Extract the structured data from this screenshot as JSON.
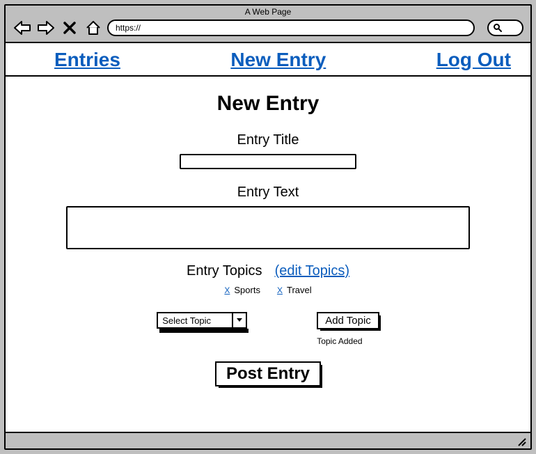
{
  "browser": {
    "title": "A Web Page",
    "url": "https://"
  },
  "nav": {
    "entries": "Entries",
    "new_entry": "New Entry",
    "log_out": "Log Out"
  },
  "page": {
    "heading": "New Entry",
    "title_label": "Entry Title",
    "text_label": "Entry Text",
    "topics_label": "Entry Topics",
    "edit_topics": "(edit Topics)",
    "chips": [
      {
        "remove": "X",
        "label": "Sports"
      },
      {
        "remove": "X",
        "label": "Travel"
      }
    ],
    "select_placeholder": "Select Topic",
    "add_topic": "Add Topic",
    "topic_added": "Topic Added",
    "post": "Post Entry"
  }
}
